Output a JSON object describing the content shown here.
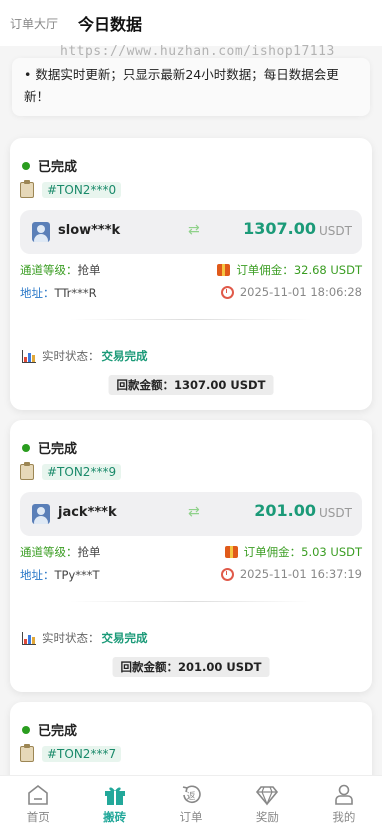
{
  "header": {
    "tab_lobby": "订单大厅",
    "tab_today": "今日数据",
    "watermark": "https://www.huzhan.com/ishop17113"
  },
  "notice": {
    "text": "• 数据实时更新；只显示最新24小时数据；每日数据会更新！"
  },
  "labels": {
    "channel": "通道等级：",
    "address": "地址：",
    "commission": "订单佣金：",
    "realtime": "实时状态：",
    "refund": "回款金额："
  },
  "orders": [
    {
      "status": "已完成",
      "order_id": "#TON2***0",
      "username": "slow***k",
      "amount": "1307.00",
      "unit": "USDT",
      "channel": "抢单",
      "address": "TTr***R",
      "commission": "32.68 USDT",
      "time": "2025-11-01 18:06:28",
      "realtime": "交易完成",
      "refund": "1307.00 USDT"
    },
    {
      "status": "已完成",
      "order_id": "#TON2***9",
      "username": "jack***k",
      "amount": "201.00",
      "unit": "USDT",
      "channel": "抢单",
      "address": "TPy***T",
      "commission": "5.03 USDT",
      "time": "2025-11-01 16:37:19",
      "realtime": "交易完成",
      "refund": "201.00 USDT"
    },
    {
      "status": "已完成",
      "order_id": "#TON2***7"
    }
  ],
  "nav": [
    {
      "label": "首页",
      "icon": "home-icon"
    },
    {
      "label": "搬砖",
      "icon": "gift-box-icon",
      "active": true
    },
    {
      "label": "订单",
      "icon": "return-order-icon"
    },
    {
      "label": "奖励",
      "icon": "diamond-icon"
    },
    {
      "label": "我的",
      "icon": "user-icon"
    }
  ],
  "colors": {
    "accent": "#23a89a",
    "amount": "#1b9a78",
    "status_dot": "#2a9d1f"
  }
}
